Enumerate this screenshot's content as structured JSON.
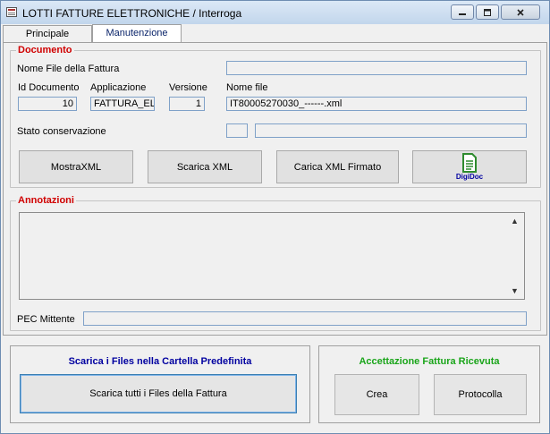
{
  "window": {
    "title": "LOTTI FATTURE ELETTRONICHE / Interroga",
    "min_icon": "minimize-icon",
    "max_icon": "maximize-icon",
    "close_icon": "close-icon"
  },
  "tabs": [
    {
      "label": "Principale",
      "active": false
    },
    {
      "label": "Manutenzione",
      "active": true
    }
  ],
  "documento": {
    "title": "Documento",
    "nome_file_fattura_label": "Nome File della Fattura",
    "nome_file_fattura_value": "",
    "id_documento_label": "Id Documento",
    "id_documento_value": "10",
    "applicazione_label": "Applicazione",
    "applicazione_value": "FATTURA_EL",
    "versione_label": "Versione",
    "versione_value": "1",
    "nome_file_label": "Nome file",
    "nome_file_value": "IT80005270030_------.xml",
    "stato_conservazione_label": "Stato conservazione",
    "stato_code_value": "",
    "stato_desc_value": "",
    "buttons": {
      "mostra_xml": "MostraXML",
      "scarica_xml": "Scarica XML",
      "carica_xml_firmato": "Carica XML Firmato",
      "digidoc": "DigiDoc"
    }
  },
  "annotazioni": {
    "title": "Annotazioni",
    "text": "",
    "pec_mittente_label": "PEC Mittente",
    "pec_mittente_value": ""
  },
  "scarica_panel": {
    "title": "Scarica i Files nella Cartella Predefinita",
    "button": "Scarica tutti i Files della Fattura"
  },
  "accettazione_panel": {
    "title": "Accettazione Fattura Ricevuta",
    "crea_button": "Crea",
    "protocolla_button": "Protocolla"
  },
  "colors": {
    "group_title": "#d00000",
    "scarica_title": "#0000a0",
    "accettazione_title": "#1aa51a",
    "digidoc_icon": "#2e8b2e",
    "field_border": "#7fa1c8"
  }
}
